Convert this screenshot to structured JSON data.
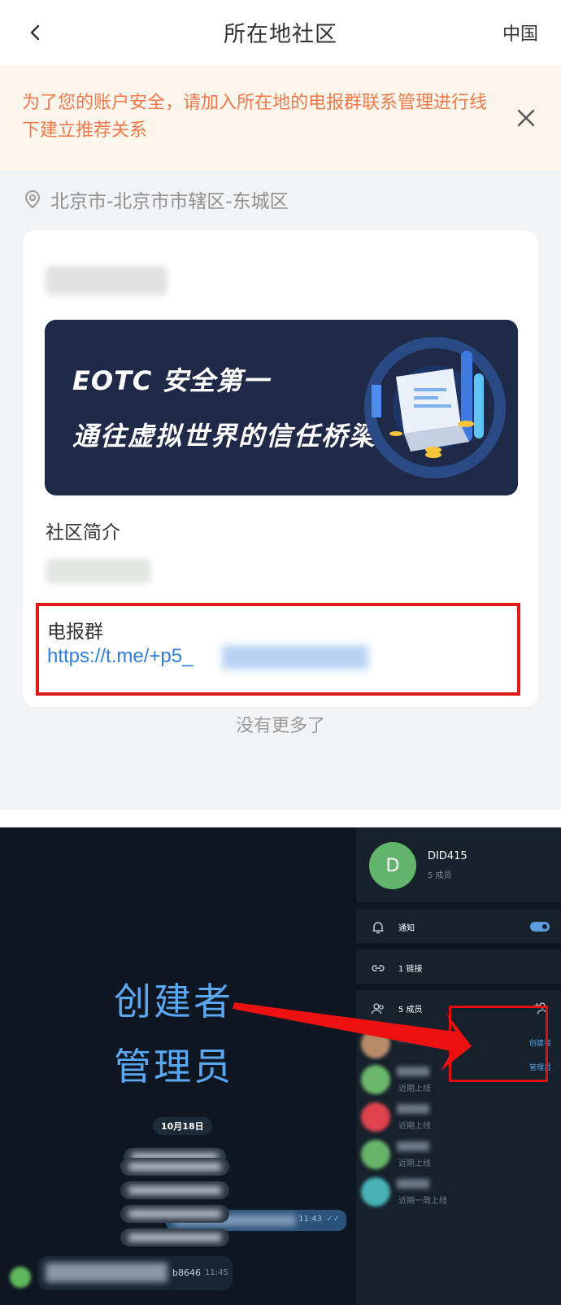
{
  "header": {
    "title": "所在地社区",
    "right_label": "中国"
  },
  "notice": {
    "text": "为了您的账户安全，请加入所在地的电报群联系管理进行线下建立推荐关系"
  },
  "location": {
    "text": "北京市-北京市市辖区-东城区"
  },
  "community": {
    "banner": {
      "line1": "EOTC 安全第一",
      "line2": "通往虚拟世界的信任桥梁"
    },
    "intro_label": "社区简介",
    "telegram": {
      "label": "电报群",
      "link": "https://t.me/+p5_"
    }
  },
  "footer": {
    "no_more": "没有更多了"
  },
  "telegram_screenshot": {
    "overlay": {
      "creator": "创建者",
      "admin": "管理员"
    },
    "date_pill": "10月18日",
    "outgoing_time": "11:43",
    "last_message": {
      "tail": "b8646",
      "time": "11:45"
    },
    "group": {
      "avatar_letter": "D",
      "name": "DID415",
      "subtitle": "5 成员"
    },
    "rows": {
      "notify": "通知",
      "links": "1 链接",
      "members": "5 成员"
    },
    "roles": {
      "creator": "创建者",
      "admin": "管理员"
    },
    "members": [
      {
        "status": "",
        "color": "#b58b6a"
      },
      {
        "status": "近期上线",
        "color": "#6bb76a"
      },
      {
        "status": "近期上线",
        "color": "#e0434e"
      },
      {
        "status": "近期上线",
        "color": "#66b46a"
      },
      {
        "status": "近期一周上线",
        "color": "#49b2b7"
      }
    ]
  }
}
